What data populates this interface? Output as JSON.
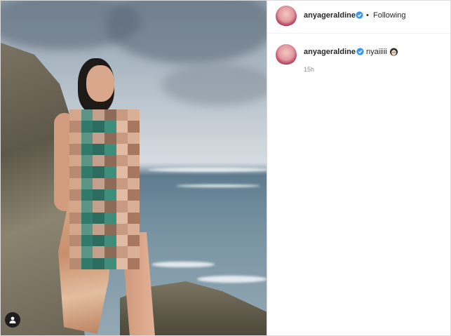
{
  "post": {
    "author": "anyageraldine",
    "follow_separator": "•",
    "follow_status": "Following"
  },
  "comment": {
    "author": "anyageraldine",
    "text": "nyaiiiii",
    "emoji": "face-with-hair-emoji",
    "time": "15h"
  },
  "icons": {
    "verified": "verified-badge-icon",
    "user_tag": "user-tag-icon"
  },
  "colors": {
    "verified": "#3897f0",
    "avatar_ring": "#e1306c",
    "muted_text": "#8e8e8e"
  }
}
